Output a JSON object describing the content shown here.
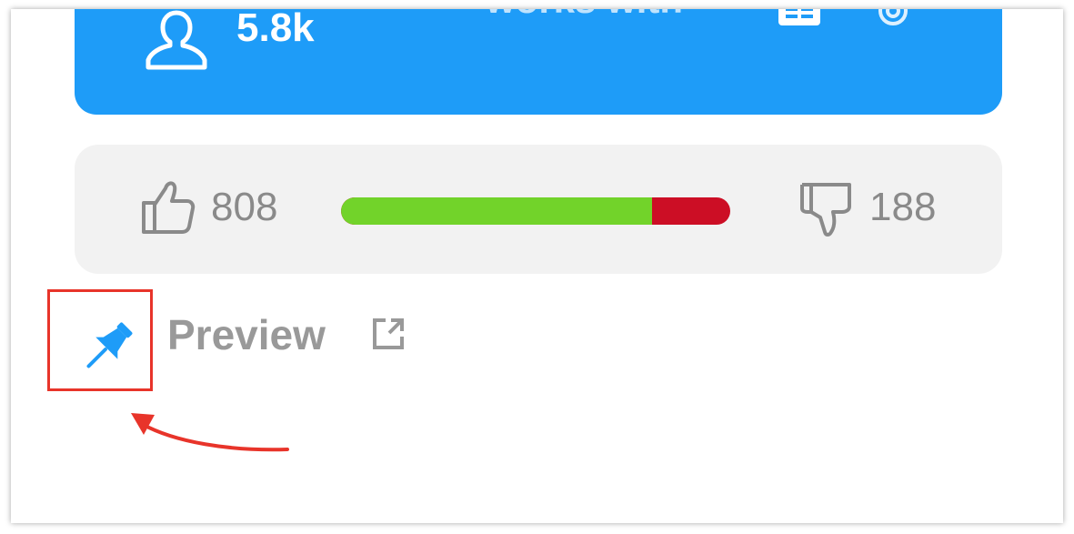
{
  "header_card": {
    "users_count": "5.8k",
    "works_with_label": "works with",
    "background_color": "#1e9cf8",
    "icons": [
      "user-icon",
      "table-icon",
      "location-icon"
    ]
  },
  "rating": {
    "likes": "808",
    "dislikes": "188",
    "like_ratio": 0.8,
    "like_color": "#72d32a",
    "dislike_color": "#cc0e25"
  },
  "preview": {
    "label": "Preview",
    "pin_color": "#1e9cf8",
    "highlight_color": "#e8342a"
  }
}
